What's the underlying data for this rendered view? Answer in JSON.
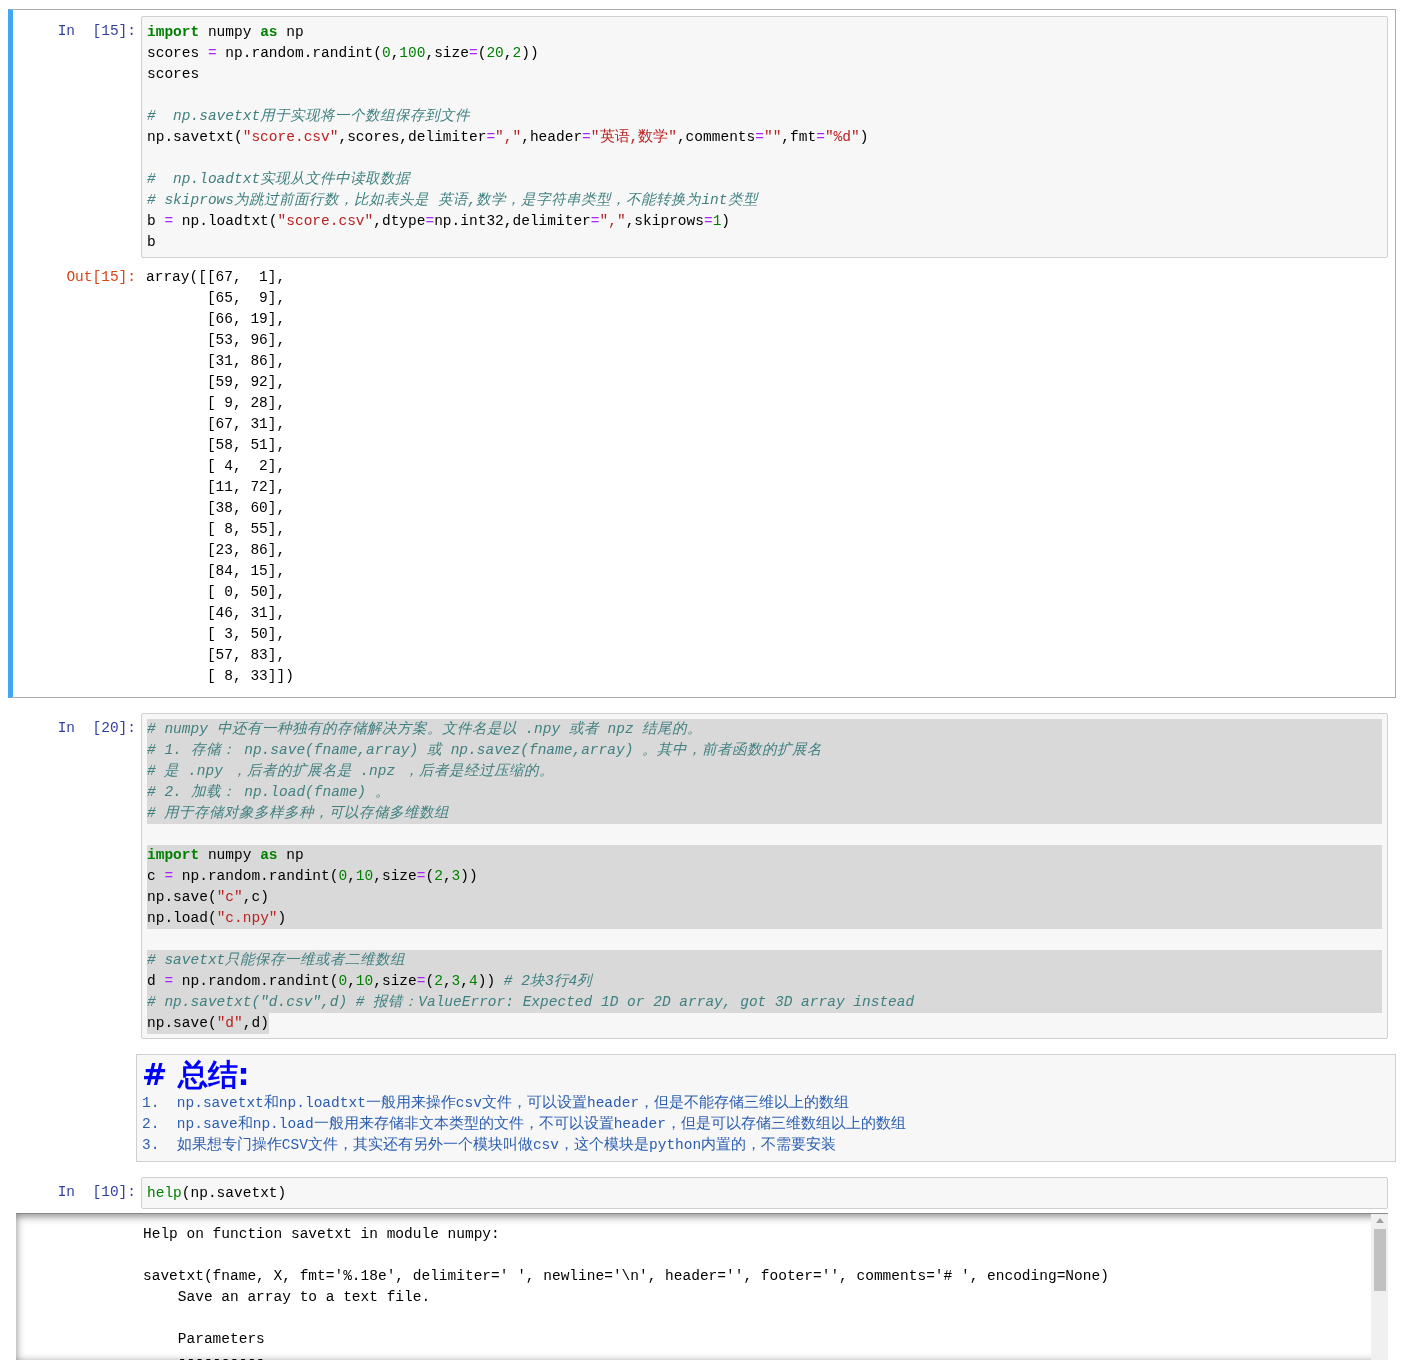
{
  "cells": [
    {
      "kind": "code",
      "prompt": "In  [15]:",
      "selected": true,
      "text_selected": false,
      "blocks": [
        [
          [
            {
              "kind": "k",
              "text": "import"
            },
            {
              "kind": "p",
              "text": " numpy "
            },
            {
              "kind": "k",
              "text": "as"
            },
            {
              "kind": "p",
              "text": " np"
            }
          ],
          [
            {
              "kind": "p",
              "text": "scores "
            },
            {
              "kind": "o",
              "text": "="
            },
            {
              "kind": "p",
              "text": " np.random.randint("
            },
            {
              "kind": "n",
              "text": "0"
            },
            {
              "kind": "p",
              "text": ","
            },
            {
              "kind": "n",
              "text": "100"
            },
            {
              "kind": "p",
              "text": ",size"
            },
            {
              "kind": "o",
              "text": "="
            },
            {
              "kind": "p",
              "text": "("
            },
            {
              "kind": "n",
              "text": "20"
            },
            {
              "kind": "p",
              "text": ","
            },
            {
              "kind": "n",
              "text": "2"
            },
            {
              "kind": "p",
              "text": "))"
            }
          ],
          [
            {
              "kind": "p",
              "text": "scores"
            }
          ]
        ],
        [
          [
            {
              "kind": "c",
              "text": "#  np.savetxt用于实现将一个数组保存到文件"
            }
          ],
          [
            {
              "kind": "p",
              "text": "np.savetxt("
            },
            {
              "kind": "s",
              "text": "\"score.csv\""
            },
            {
              "kind": "p",
              "text": ",scores,delimiter"
            },
            {
              "kind": "o",
              "text": "="
            },
            {
              "kind": "s",
              "text": "\",\""
            },
            {
              "kind": "p",
              "text": ",header"
            },
            {
              "kind": "o",
              "text": "="
            },
            {
              "kind": "s",
              "text": "\"英语,数学\""
            },
            {
              "kind": "p",
              "text": ",comments"
            },
            {
              "kind": "o",
              "text": "="
            },
            {
              "kind": "s",
              "text": "\"\""
            },
            {
              "kind": "p",
              "text": ",fmt"
            },
            {
              "kind": "o",
              "text": "="
            },
            {
              "kind": "s",
              "text": "\"%d\""
            },
            {
              "kind": "p",
              "text": ")"
            }
          ]
        ],
        [
          [
            {
              "kind": "c",
              "text": "#  np.loadtxt实现从文件中读取数据"
            }
          ],
          [
            {
              "kind": "c",
              "text": "# skiprows为跳过前面行数，比如表头是 英语,数学，是字符串类型，不能转换为int类型"
            }
          ],
          [
            {
              "kind": "p",
              "text": "b "
            },
            {
              "kind": "o",
              "text": "="
            },
            {
              "kind": "p",
              "text": " np.loadtxt("
            },
            {
              "kind": "s",
              "text": "\"score.csv\""
            },
            {
              "kind": "p",
              "text": ",dtype"
            },
            {
              "kind": "o",
              "text": "="
            },
            {
              "kind": "p",
              "text": "np.int32,delimiter"
            },
            {
              "kind": "o",
              "text": "="
            },
            {
              "kind": "s",
              "text": "\",\""
            },
            {
              "kind": "p",
              "text": ",skiprows"
            },
            {
              "kind": "o",
              "text": "="
            },
            {
              "kind": "n",
              "text": "1"
            },
            {
              "kind": "p",
              "text": ")"
            }
          ],
          [
            {
              "kind": "p",
              "text": "b"
            }
          ]
        ]
      ],
      "output": {
        "kind": "result",
        "prompt": "Out[15]:",
        "blocks": [
          [
            "array([[67,  1],",
            "       [65,  9],",
            "       [66, 19],",
            "       [53, 96],",
            "       [31, 86],",
            "       [59, 92],",
            "       [ 9, 28],",
            "       [67, 31],",
            "       [58, 51],",
            "       [ 4,  2],",
            "       [11, 72],",
            "       [38, 60],",
            "       [ 8, 55],",
            "       [23, 86],",
            "       [84, 15],",
            "       [ 0, 50],",
            "       [46, 31],",
            "       [ 3, 50],",
            "       [57, 83],",
            "       [ 8, 33]])"
          ]
        ]
      }
    },
    {
      "kind": "code",
      "prompt": "In  [20]:",
      "selected": false,
      "text_selected": true,
      "blocks": [
        [
          [
            {
              "kind": "c",
              "text": "# numpy 中还有一种独有的存储解决方案。文件名是以 .npy 或者 npz 结尾的。"
            }
          ],
          [
            {
              "kind": "c",
              "text": "# 1. 存储： np.save(fname,array) 或 np.savez(fname,array) 。其中，前者函数的扩展名"
            }
          ],
          [
            {
              "kind": "c",
              "text": "# 是 .npy ，后者的扩展名是 .npz ，后者是经过压缩的。"
            }
          ],
          [
            {
              "kind": "c",
              "text": "# 2. 加载： np.load(fname) 。"
            }
          ],
          [
            {
              "kind": "c",
              "text": "# 用于存储对象多样多种，可以存储多维数组"
            }
          ]
        ],
        [
          [
            {
              "kind": "k",
              "text": "import"
            },
            {
              "kind": "p",
              "text": " numpy "
            },
            {
              "kind": "k",
              "text": "as"
            },
            {
              "kind": "p",
              "text": " np"
            }
          ],
          [
            {
              "kind": "p",
              "text": "c "
            },
            {
              "kind": "o",
              "text": "="
            },
            {
              "kind": "p",
              "text": " np.random.randint("
            },
            {
              "kind": "n",
              "text": "0"
            },
            {
              "kind": "p",
              "text": ","
            },
            {
              "kind": "n",
              "text": "10"
            },
            {
              "kind": "p",
              "text": ",size"
            },
            {
              "kind": "o",
              "text": "="
            },
            {
              "kind": "p",
              "text": "("
            },
            {
              "kind": "n",
              "text": "2"
            },
            {
              "kind": "p",
              "text": ","
            },
            {
              "kind": "n",
              "text": "3"
            },
            {
              "kind": "p",
              "text": "))"
            }
          ],
          [
            {
              "kind": "p",
              "text": "np.save("
            },
            {
              "kind": "s",
              "text": "\"c\""
            },
            {
              "kind": "p",
              "text": ",c)"
            }
          ],
          [
            {
              "kind": "p",
              "text": "np.load("
            },
            {
              "kind": "s",
              "text": "\"c.npy\""
            },
            {
              "kind": "p",
              "text": ")"
            }
          ]
        ],
        [
          [
            {
              "kind": "c",
              "text": "# savetxt只能保存一维或者二维数组"
            }
          ],
          [
            {
              "kind": "p",
              "text": "d "
            },
            {
              "kind": "o",
              "text": "="
            },
            {
              "kind": "p",
              "text": " np.random.randint("
            },
            {
              "kind": "n",
              "text": "0"
            },
            {
              "kind": "p",
              "text": ","
            },
            {
              "kind": "n",
              "text": "10"
            },
            {
              "kind": "p",
              "text": ",size"
            },
            {
              "kind": "o",
              "text": "="
            },
            {
              "kind": "p",
              "text": "("
            },
            {
              "kind": "n",
              "text": "2"
            },
            {
              "kind": "p",
              "text": ","
            },
            {
              "kind": "n",
              "text": "3"
            },
            {
              "kind": "p",
              "text": ","
            },
            {
              "kind": "n",
              "text": "4"
            },
            {
              "kind": "p",
              "text": "))"
            },
            {
              "kind": "c",
              "text": " # 2块3行4列"
            }
          ],
          [
            {
              "kind": "c",
              "text": "# np.savetxt(\"d.csv\",d) # 报错：ValueError: Expected 1D or 2D array, got 3D array instead"
            }
          ],
          [
            {
              "kind": "p",
              "text": "np.save("
            },
            {
              "kind": "s",
              "text": "\"d\""
            },
            {
              "kind": "p",
              "text": ",d)"
            }
          ]
        ]
      ]
    },
    {
      "kind": "markdown",
      "heading": "# 总结:",
      "items": [
        "1.  np.savetxt和np.loadtxt一般用来操作csv文件，可以设置header，但是不能存储三维以上的数组",
        "2.  np.save和np.load一般用来存储非文本类型的文件，不可以设置header，但是可以存储三维数组以上的数组",
        "3.  如果想专门操作CSV文件，其实还有另外一个模块叫做csv，这个模块是python内置的，不需要安装"
      ]
    },
    {
      "kind": "code",
      "prompt": "In  [10]:",
      "selected": false,
      "text_selected": false,
      "blocks": [
        [
          [
            {
              "kind": "b",
              "text": "help"
            },
            {
              "kind": "p",
              "text": "(np.savetxt)"
            }
          ]
        ]
      ],
      "output": {
        "kind": "scrolled",
        "blocks": [
          [
            "Help on function savetxt in module numpy:"
          ],
          [
            "savetxt(fname, X, fmt='%.18e', delimiter=' ', newline='\\n', header='', footer='', comments='# ', encoding=None)",
            "    Save an array to a text file."
          ],
          [
            "    Parameters",
            "    ----------"
          ]
        ]
      }
    }
  ]
}
